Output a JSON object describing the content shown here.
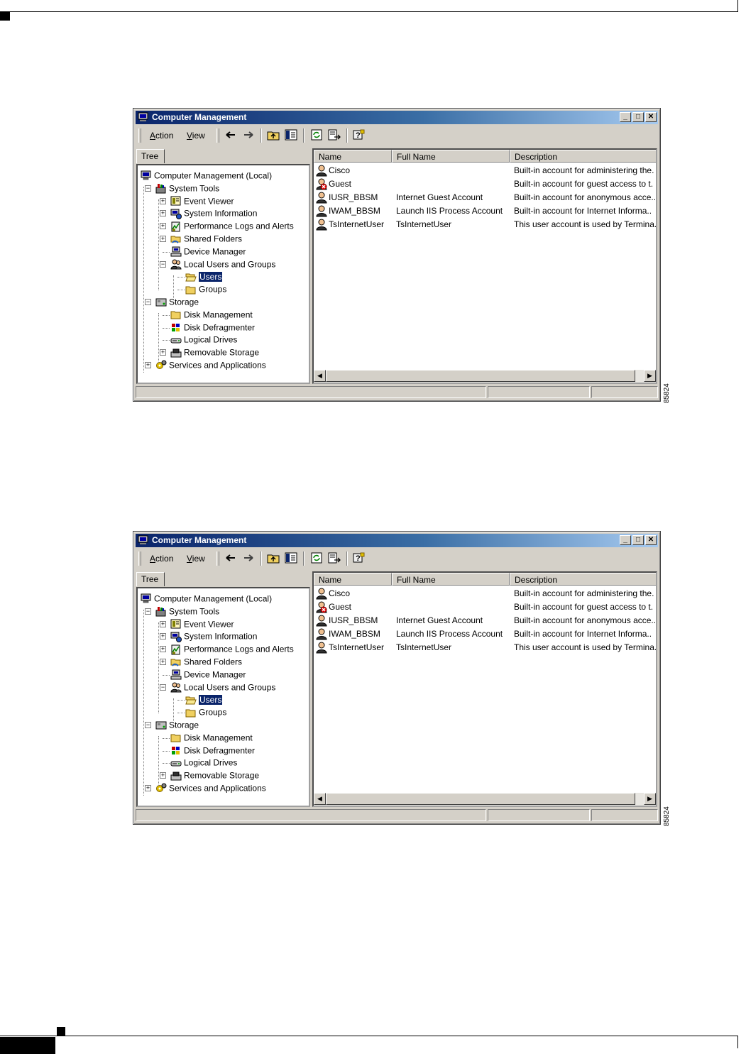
{
  "page": {
    "figure_id": "85824"
  },
  "windows": [
    {
      "title": "Computer Management",
      "menu": [
        {
          "label": "Action",
          "mnemonic": "A",
          "rest": "ction"
        },
        {
          "label": "View",
          "mnemonic": "V",
          "rest": "iew"
        }
      ],
      "tree_tab": "Tree",
      "tree": [
        {
          "label": "Computer Management (Local)",
          "icon": "computer-icon",
          "expander": ""
        },
        {
          "label": "System Tools",
          "icon": "toolbox-icon",
          "expander": "−"
        },
        {
          "label": "Event Viewer",
          "icon": "event-viewer-icon",
          "expander": "+"
        },
        {
          "label": "System Information",
          "icon": "system-info-icon",
          "expander": "+"
        },
        {
          "label": "Performance Logs and Alerts",
          "icon": "performance-icon",
          "expander": "+"
        },
        {
          "label": "Shared Folders",
          "icon": "shared-folder-icon",
          "expander": "+"
        },
        {
          "label": "Device Manager",
          "icon": "device-manager-icon",
          "expander": ""
        },
        {
          "label": "Local Users and Groups",
          "icon": "users-groups-icon",
          "expander": "−"
        },
        {
          "label": "Users",
          "icon": "open-folder-icon",
          "expander": "",
          "selected": true
        },
        {
          "label": "Groups",
          "icon": "folder-icon",
          "expander": ""
        },
        {
          "label": "Storage",
          "icon": "storage-icon",
          "expander": "−"
        },
        {
          "label": "Disk Management",
          "icon": "folder-icon",
          "expander": ""
        },
        {
          "label": "Disk Defragmenter",
          "icon": "defrag-icon",
          "expander": ""
        },
        {
          "label": "Logical Drives",
          "icon": "drive-icon",
          "expander": ""
        },
        {
          "label": "Removable Storage",
          "icon": "removable-storage-icon",
          "expander": "+"
        },
        {
          "label": "Services and Applications",
          "icon": "services-icon",
          "expander": "+"
        }
      ],
      "columns": [
        "Name",
        "Full Name",
        "Description"
      ],
      "rows": [
        {
          "name": "Cisco",
          "full_name": "",
          "description": "Built-in account for administering the.",
          "icon": "user-icon"
        },
        {
          "name": "Guest",
          "full_name": "",
          "description": "Built-in account for guest access to t.",
          "icon": "disabled-user-icon"
        },
        {
          "name": "IUSR_BBSM",
          "full_name": "Internet Guest Account",
          "description": "Built-in account for anonymous acce..",
          "icon": "user-icon"
        },
        {
          "name": "IWAM_BBSM",
          "full_name": "Launch IIS Process Account",
          "description": "Built-in account for Internet Informa..",
          "icon": "user-icon"
        },
        {
          "name": "TsInternetUser",
          "full_name": "TsInternetUser",
          "description": "This user account is used by Termina.",
          "icon": "user-icon"
        }
      ]
    },
    {
      "title": "Computer Management",
      "menu": [
        {
          "label": "Action",
          "mnemonic": "A",
          "rest": "ction"
        },
        {
          "label": "View",
          "mnemonic": "V",
          "rest": "iew"
        }
      ],
      "tree_tab": "Tree",
      "tree": [
        {
          "label": "Computer Management (Local)",
          "icon": "computer-icon",
          "expander": ""
        },
        {
          "label": "System Tools",
          "icon": "toolbox-icon",
          "expander": "−"
        },
        {
          "label": "Event Viewer",
          "icon": "event-viewer-icon",
          "expander": "+"
        },
        {
          "label": "System Information",
          "icon": "system-info-icon",
          "expander": "+"
        },
        {
          "label": "Performance Logs and Alerts",
          "icon": "performance-icon",
          "expander": "+"
        },
        {
          "label": "Shared Folders",
          "icon": "shared-folder-icon",
          "expander": "+"
        },
        {
          "label": "Device Manager",
          "icon": "device-manager-icon",
          "expander": ""
        },
        {
          "label": "Local Users and Groups",
          "icon": "users-groups-icon",
          "expander": "−"
        },
        {
          "label": "Users",
          "icon": "open-folder-icon",
          "expander": "",
          "selected": true
        },
        {
          "label": "Groups",
          "icon": "folder-icon",
          "expander": ""
        },
        {
          "label": "Storage",
          "icon": "storage-icon",
          "expander": "−"
        },
        {
          "label": "Disk Management",
          "icon": "folder-icon",
          "expander": ""
        },
        {
          "label": "Disk Defragmenter",
          "icon": "defrag-icon",
          "expander": ""
        },
        {
          "label": "Logical Drives",
          "icon": "drive-icon",
          "expander": ""
        },
        {
          "label": "Removable Storage",
          "icon": "removable-storage-icon",
          "expander": "+"
        },
        {
          "label": "Services and Applications",
          "icon": "services-icon",
          "expander": "+"
        }
      ],
      "columns": [
        "Name",
        "Full Name",
        "Description"
      ],
      "rows": [
        {
          "name": "Cisco",
          "full_name": "",
          "description": "Built-in account for administering the.",
          "icon": "user-icon"
        },
        {
          "name": "Guest",
          "full_name": "",
          "description": "Built-in account for guest access to t.",
          "icon": "disabled-user-icon"
        },
        {
          "name": "IUSR_BBSM",
          "full_name": "Internet Guest Account",
          "description": "Built-in account for anonymous acce..",
          "icon": "user-icon"
        },
        {
          "name": "IWAM_BBSM",
          "full_name": "Launch IIS Process Account",
          "description": "Built-in account for Internet Informa..",
          "icon": "user-icon"
        },
        {
          "name": "TsInternetUser",
          "full_name": "TsInternetUser",
          "description": "This user account is used by Termina.",
          "icon": "user-icon"
        }
      ]
    }
  ]
}
